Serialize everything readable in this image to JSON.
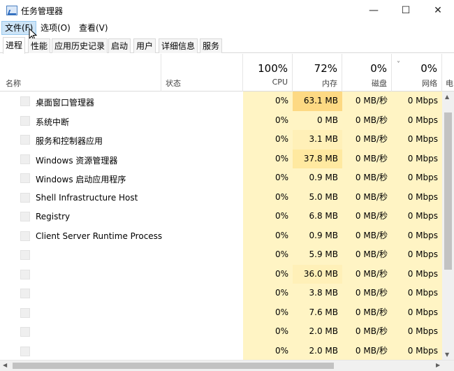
{
  "window": {
    "title": "任务管理器",
    "minimize_glyph": "—",
    "maximize_glyph": "☐",
    "close_glyph": "✕"
  },
  "menu": [
    "文件(F)",
    "选项(O)",
    "查看(V)"
  ],
  "tabs": [
    "进程",
    "性能",
    "应用历史记录",
    "启动",
    "用户",
    "详细信息",
    "服务"
  ],
  "header": {
    "name_label": "名称",
    "status_label": "状态",
    "sort_glyph": "˅",
    "cpu": {
      "pct": "100%",
      "label": "CPU"
    },
    "mem": {
      "pct": "72%",
      "label": "内存"
    },
    "disk": {
      "pct": "0%",
      "label": "磁盘"
    },
    "net": {
      "pct": "0%",
      "label": "网络"
    },
    "edge_label": "电"
  },
  "rows": [
    {
      "name": "桌面窗口管理器",
      "cpu": "0%",
      "mem": "63.1 MB",
      "disk": "0 MB/秒",
      "net": "0 Mbps"
    },
    {
      "name": "系统中断",
      "cpu": "0%",
      "mem": "0 MB",
      "disk": "0 MB/秒",
      "net": "0 Mbps"
    },
    {
      "name": "服务和控制器应用",
      "cpu": "0%",
      "mem": "3.1 MB",
      "disk": "0 MB/秒",
      "net": "0 Mbps"
    },
    {
      "name": "Windows 资源管理器",
      "cpu": "0%",
      "mem": "37.8 MB",
      "disk": "0 MB/秒",
      "net": "0 Mbps"
    },
    {
      "name": "Windows 启动应用程序",
      "cpu": "0%",
      "mem": "0.9 MB",
      "disk": "0 MB/秒",
      "net": "0 Mbps"
    },
    {
      "name": "Shell Infrastructure Host",
      "cpu": "0%",
      "mem": "5.0 MB",
      "disk": "0 MB/秒",
      "net": "0 Mbps"
    },
    {
      "name": "Registry",
      "cpu": "0%",
      "mem": "6.8 MB",
      "disk": "0 MB/秒",
      "net": "0 Mbps"
    },
    {
      "name": "Client Server Runtime Process",
      "cpu": "0%",
      "mem": "0.9 MB",
      "disk": "0 MB/秒",
      "net": "0 Mbps"
    },
    {
      "name": "",
      "cpu": "0%",
      "mem": "5.9 MB",
      "disk": "0 MB/秒",
      "net": "0 Mbps"
    },
    {
      "name": "",
      "cpu": "0%",
      "mem": "36.0 MB",
      "disk": "0 MB/秒",
      "net": "0 Mbps"
    },
    {
      "name": "",
      "cpu": "0%",
      "mem": "3.8 MB",
      "disk": "0 MB/秒",
      "net": "0 Mbps"
    },
    {
      "name": "",
      "cpu": "0%",
      "mem": "7.6 MB",
      "disk": "0 MB/秒",
      "net": "0 Mbps"
    },
    {
      "name": "",
      "cpu": "0%",
      "mem": "2.0 MB",
      "disk": "0 MB/秒",
      "net": "0 Mbps"
    },
    {
      "name": "",
      "cpu": "0%",
      "mem": "2.0 MB",
      "disk": "0 MB/秒",
      "net": "0 Mbps"
    }
  ],
  "scroll": {
    "up": "▲",
    "down": "▼",
    "left": "◀",
    "right": "▶"
  }
}
